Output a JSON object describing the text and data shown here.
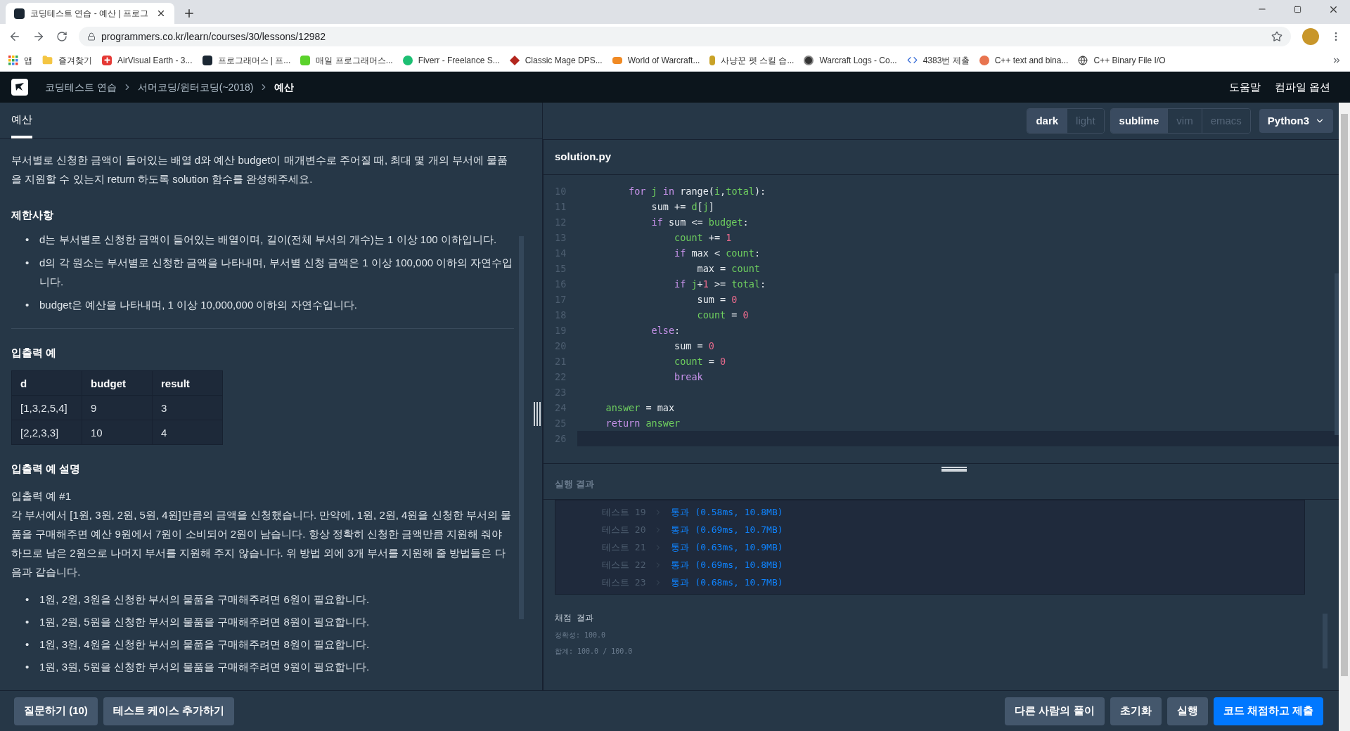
{
  "browser": {
    "tab_title": "코딩테스트 연습 - 예산 | 프로그",
    "url": "programmers.co.kr/learn/courses/30/lessons/12982",
    "bookmarks": [
      {
        "label": "앱",
        "kind": "apps"
      },
      {
        "label": "즐겨찾기",
        "kind": "folder"
      },
      {
        "label": "AirVisual Earth - 3...",
        "kind": "red"
      },
      {
        "label": "프로그래머스 | 프...",
        "kind": "prog"
      },
      {
        "label": "매일 프로그래머스...",
        "kind": "green"
      },
      {
        "label": "Fiverr - Freelance S...",
        "kind": "fiverr"
      },
      {
        "label": "Classic Mage DPS...",
        "kind": "mage"
      },
      {
        "label": "World of Warcraft...",
        "kind": "wow"
      },
      {
        "label": "사냥꾼 펫 스킬 습...",
        "kind": "hunter"
      },
      {
        "label": "Warcraft Logs - Co...",
        "kind": "logs"
      },
      {
        "label": "4383번 제출",
        "kind": "code"
      },
      {
        "label": "C++ text and bina...",
        "kind": "cpp"
      },
      {
        "label": "C++ Binary File I/O",
        "kind": "globe"
      }
    ]
  },
  "header": {
    "breadcrumbs": [
      {
        "label": "코딩테스트 연습",
        "current": false
      },
      {
        "label": "서머코딩/윈터코딩(~2018)",
        "current": false
      },
      {
        "label": "예산",
        "current": true
      }
    ],
    "links": [
      "도움말",
      "컴파일 옵션"
    ]
  },
  "problem": {
    "tabs": [
      {
        "label": "예산",
        "selected": true
      }
    ],
    "description": "부서별로 신청한 금액이 들어있는 배열 d와 예산 budget이 매개변수로 주어질 때, 최대 몇 개의 부서에 물품을 지원할 수 있는지 return 하도록 solution 함수를 완성해주세요.",
    "constraints_title": "제한사항",
    "constraints": [
      {
        "marker": "•",
        "text": "d는 부서별로 신청한 금액이 들어있는 배열이며, 길이(전체 부서의 개수)는 1 이상 100 이하입니다."
      },
      {
        "marker": "•",
        "text": "d의 각 원소는 부서별로 신청한 금액을 나타내며, 부서별 신청 금액은 1 이상 100,000 이하의 자연수입니다."
      },
      {
        "marker": "•",
        "text": "budget은 예산을 나타내며, 1 이상 10,000,000 이하의 자연수입니다."
      }
    ],
    "examples_title": "입출력 예",
    "table": {
      "columns": [
        "d",
        "budget",
        "result"
      ],
      "rows": [
        [
          "[1,3,2,5,4]",
          "9",
          "3"
        ],
        [
          "[2,2,3,3]",
          "10",
          "4"
        ]
      ]
    },
    "explanation_title": "입출력 예 설명",
    "example_label": "입출력 예 #1",
    "explanation": "각 부서에서 [1원, 3원, 2원, 5원, 4원]만큼의 금액을 신청했습니다. 만약에, 1원, 2원, 4원을 신청한 부서의 물품을 구매해주면 예산 9원에서 7원이 소비되어 2원이 남습니다. 항상 정확히 신청한 금액만큼 지원해 줘야 하므로 남은 2원으로 나머지 부서를 지원해 주지 않습니다. 위 방법 외에 3개 부서를 지원해 줄 방법들은 다음과 같습니다.",
    "bullets": [
      {
        "marker": "•",
        "text": "1원, 2원, 3원을 신청한 부서의 물품을 구매해주려면 6원이 필요합니다."
      },
      {
        "marker": "•",
        "text": "1원, 2원, 5원을 신청한 부서의 물품을 구매해주려면 8원이 필요합니다."
      },
      {
        "marker": "•",
        "text": "1원, 3원, 4원을 신청한 부서의 물품을 구매해주려면 8원이 필요합니다."
      },
      {
        "marker": "•",
        "text": "1원, 3원, 5원을 신청한 부서의 물품을 구매해주려면 9원이 필요합니다."
      }
    ]
  },
  "toolbar": {
    "themes": [
      {
        "label": "dark",
        "selected": true
      },
      {
        "label": "light",
        "selected": false
      }
    ],
    "keymaps": [
      {
        "label": "sublime",
        "selected": true
      },
      {
        "label": "vim",
        "selected": false
      },
      {
        "label": "emacs",
        "selected": false
      }
    ],
    "language": "Python3"
  },
  "editor": {
    "filename": "solution.py",
    "lines": [
      {
        "number": "10",
        "active": false,
        "tokens": [
          {
            "text": "        for",
            "color": "#c792ea"
          },
          {
            "text": " j",
            "color": "#6fcf5f"
          },
          {
            "text": " in",
            "color": "#c792ea"
          },
          {
            "text": " range("
          },
          {
            "text": "i",
            "color": "#6fcf5f"
          },
          {
            "text": ","
          },
          {
            "text": "total",
            "color": "#6fcf5f"
          },
          {
            "text": "):"
          }
        ]
      },
      {
        "number": "11",
        "active": false,
        "tokens": [
          {
            "text": "            sum +="
          },
          {
            "text": " d",
            "color": "#6fcf5f"
          },
          {
            "text": "["
          },
          {
            "text": "j",
            "color": "#6fcf5f"
          },
          {
            "text": "]"
          }
        ]
      },
      {
        "number": "12",
        "active": false,
        "tokens": [
          {
            "text": "            if",
            "color": "#c792ea"
          },
          {
            "text": " sum <="
          },
          {
            "text": " budget",
            "color": "#6fcf5f"
          },
          {
            "text": ":"
          }
        ]
      },
      {
        "number": "13",
        "active": false,
        "tokens": [
          {
            "text": "                count",
            "color": "#6fcf5f"
          },
          {
            "text": " +="
          },
          {
            "text": " 1",
            "color": "#e86a8c"
          }
        ]
      },
      {
        "number": "14",
        "active": false,
        "tokens": [
          {
            "text": "                if",
            "color": "#c792ea"
          },
          {
            "text": " max <"
          },
          {
            "text": " count",
            "color": "#6fcf5f"
          },
          {
            "text": ":"
          }
        ]
      },
      {
        "number": "15",
        "active": false,
        "tokens": [
          {
            "text": "                    max ="
          },
          {
            "text": " count",
            "color": "#6fcf5f"
          }
        ]
      },
      {
        "number": "16",
        "active": false,
        "tokens": [
          {
            "text": "                if",
            "color": "#c792ea"
          },
          {
            "text": " j",
            "color": "#6fcf5f"
          },
          {
            "text": "+"
          },
          {
            "text": "1",
            "color": "#e86a8c"
          },
          {
            "text": " >="
          },
          {
            "text": " total",
            "color": "#6fcf5f"
          },
          {
            "text": ":"
          }
        ]
      },
      {
        "number": "17",
        "active": false,
        "tokens": [
          {
            "text": "                    sum ="
          },
          {
            "text": " 0",
            "color": "#e86a8c"
          }
        ]
      },
      {
        "number": "18",
        "active": false,
        "tokens": [
          {
            "text": "                    count",
            "color": "#6fcf5f"
          },
          {
            "text": " ="
          },
          {
            "text": " 0",
            "color": "#e86a8c"
          }
        ]
      },
      {
        "number": "19",
        "active": false,
        "tokens": [
          {
            "text": "            else",
            "color": "#c792ea"
          },
          {
            "text": ":"
          }
        ]
      },
      {
        "number": "20",
        "active": false,
        "tokens": [
          {
            "text": "                sum ="
          },
          {
            "text": " 0",
            "color": "#e86a8c"
          }
        ]
      },
      {
        "number": "21",
        "active": false,
        "tokens": [
          {
            "text": "                count",
            "color": "#6fcf5f"
          },
          {
            "text": " ="
          },
          {
            "text": " 0",
            "color": "#e86a8c"
          }
        ]
      },
      {
        "number": "22",
        "active": false,
        "tokens": [
          {
            "text": "                break",
            "color": "#c792ea"
          }
        ]
      },
      {
        "number": "23",
        "active": false
      },
      {
        "number": "24",
        "active": false,
        "tokens": [
          {
            "text": "    answer",
            "color": "#6fcf5f"
          },
          {
            "text": " = max"
          }
        ]
      },
      {
        "number": "25",
        "active": false,
        "tokens": [
          {
            "text": "    return",
            "color": "#c792ea"
          },
          {
            "text": " answer",
            "color": "#6fcf5f"
          }
        ]
      },
      {
        "number": "26",
        "active": true
      }
    ]
  },
  "results": {
    "title": "실행 결과",
    "tests": [
      {
        "label": "테스트 19",
        "result": "통과 (0.58ms, 10.8MB)"
      },
      {
        "label": "테스트 20",
        "result": "통과 (0.69ms, 10.7MB)"
      },
      {
        "label": "테스트 21",
        "result": "통과 (0.63ms, 10.9MB)"
      },
      {
        "label": "테스트 22",
        "result": "통과 (0.69ms, 10.8MB)"
      },
      {
        "label": "테스트 23",
        "result": "통과 (0.68ms, 10.7MB)"
      }
    ],
    "grading_title": "채점 결과",
    "accuracy": "정확성: 100.0",
    "total": "합계: 100.0 / 100.0"
  },
  "footer": {
    "left_buttons": [
      {
        "label": "질문하기 (10)",
        "kind": "secondary"
      },
      {
        "label": "테스트 케이스 추가하기",
        "kind": "secondary"
      }
    ],
    "right_buttons": [
      {
        "label": "다른 사람의 풀이",
        "kind": "secondary"
      },
      {
        "label": "초기화",
        "kind": "secondary"
      },
      {
        "label": "실행",
        "kind": "secondary"
      },
      {
        "label": "코드 채점하고 제출",
        "kind": "primary"
      }
    ]
  }
}
